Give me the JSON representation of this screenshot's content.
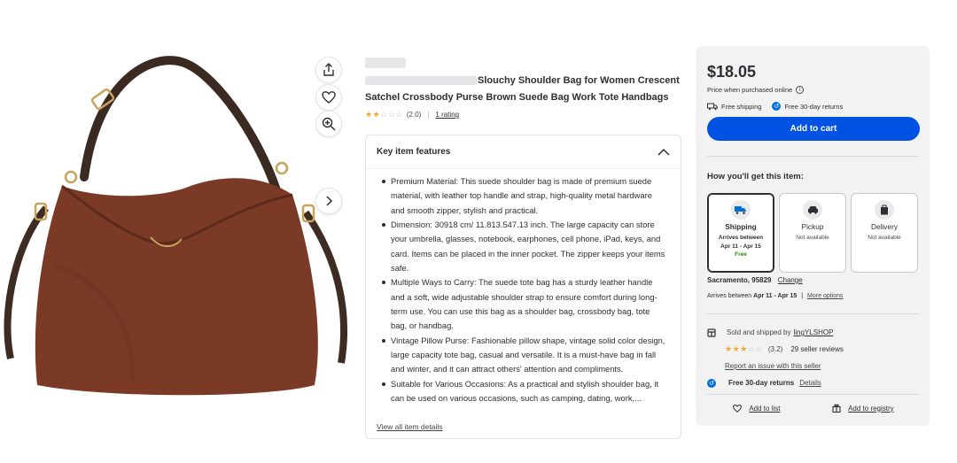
{
  "image_tools": {
    "share": "share-icon",
    "favorite": "heart-icon",
    "zoom": "zoom-in-icon",
    "next": "chevron-right-icon"
  },
  "product": {
    "title": "Slouchy Shoulder Bag for Women Crescent Satchel Crossbody Purse Brown Suede Bag Work Tote Handbags",
    "rating_stars": 2,
    "rating_value": "(2.0)",
    "rating_separator": "|",
    "rating_count": "1 rating"
  },
  "features": {
    "heading": "Key item features",
    "items": [
      "Premium Material: This suede shoulder bag is made of premium suede material, with leather top handle and strap, high-quality metal hardware and smooth zipper, stylish and practical.",
      "Dimension: 30918 cm/ 11.813.547.13 inch. The large capacity can store your umbrella, glasses, notebook, earphones, cell phone, iPad, keys, and card. Items can be placed in the inner pocket. The zipper keeps your items safe.",
      "Multiple Ways to Carry: The suede tote bag has a sturdy leather handle and a soft, wide adjustable shoulder strap to ensure comfort during long-term use. You can use this bag as a shoulder bag, crossbody bag, tote bag, or handbag.",
      "Vintage Pillow Purse: Fashionable pillow shape, vintage solid color design, large capacity tote bag, casual and versatile. It is a must-have bag in fall and winter, and it can attract others' attention and compliments.",
      "Suitable for Various Occasions: As a practical and stylish shoulder bag, it can be used on various occasions, such as camping, dating, work,..."
    ],
    "view_all": "View all item details"
  },
  "buybox": {
    "price": "$18.05",
    "price_note": "Price when purchased online",
    "info_glyph": "i",
    "free_shipping": "Free shipping",
    "free_returns": "Free 30-day returns",
    "add_to_cart": "Add to cart",
    "get_heading": "How you'll get this item:",
    "options": [
      {
        "title": "Shipping",
        "sub1": "Arrives between",
        "sub2": "Apr 11 - Apr 15",
        "free": "Free",
        "icon": "truck-icon"
      },
      {
        "title": "Pickup",
        "sub1": "Not available",
        "icon": "car-icon"
      },
      {
        "title": "Delivery",
        "sub1": "Not available",
        "icon": "bag-icon"
      }
    ],
    "location": "Sacramento, 95829",
    "change": "Change",
    "arrives_prefix": "Arrives between",
    "arrives_dates": "Apr 11 - Apr 15",
    "arrives_separator": "|",
    "more_options": "More options",
    "sold_by_prefix": "Sold and shipped by",
    "seller": "lingYLSHOP",
    "seller_rating": "(3.2)",
    "seller_stars": 3,
    "seller_reviews": "29 seller reviews",
    "report": "Report an issue with this seller",
    "free_returns_label": "Free 30-day returns",
    "details": "Details",
    "add_to_list": "Add to list",
    "add_to_registry": "Add to registry"
  },
  "colors": {
    "primary_button": "#0053e2",
    "star": "#f5a623",
    "free_green": "#2a8703",
    "bag_brown": "#7a3a26"
  }
}
